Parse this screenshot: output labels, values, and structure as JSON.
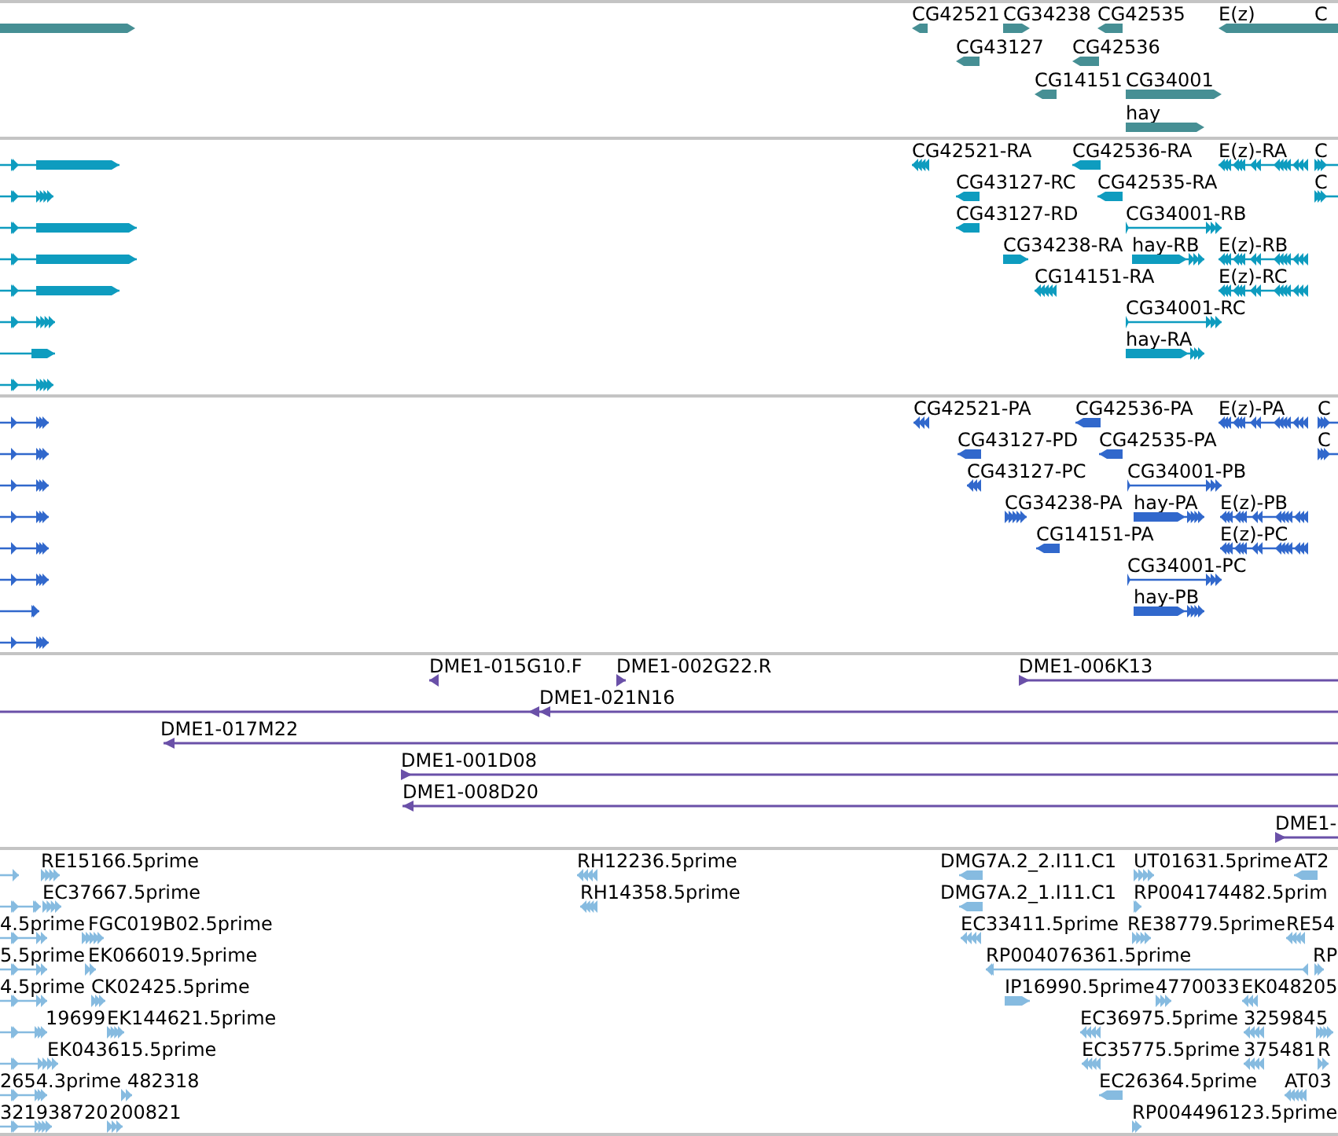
{
  "tracks": [
    {
      "kind": "gene",
      "color": "#468f94",
      "features": [
        {
          "reverse": false
        },
        {
          "label": "CG42521",
          "reverse": true
        },
        {
          "label": "CG34238",
          "reverse": false
        },
        {
          "label": "CG42535",
          "reverse": true
        },
        {
          "label": "E(z)",
          "reverse": true
        },
        {
          "label": "C",
          "reverse": false
        },
        {
          "label": "CG43127",
          "reverse": true
        },
        {
          "label": "CG42536",
          "reverse": true
        },
        {
          "label": "CG14151",
          "reverse": true
        },
        {
          "label": "CG34001",
          "reverse": false
        },
        {
          "label": "hay",
          "reverse": false
        }
      ]
    },
    {
      "kind": "transcript",
      "color": "#0e9cbf",
      "features": [
        {
          "reverse": false
        },
        {
          "label": "CG42521-RA",
          "reverse": true
        },
        {
          "label": "CG42536-RA",
          "reverse": true
        },
        {
          "label": "E(z)-RA",
          "reverse": true
        },
        {
          "label": "C",
          "reverse": false
        },
        {
          "reverse": false
        },
        {
          "label": "CG43127-RC",
          "reverse": true
        },
        {
          "label": "CG42535-RA",
          "reverse": true
        },
        {
          "label": "C",
          "reverse": false
        },
        {
          "reverse": false
        },
        {
          "label": "CG43127-RD",
          "reverse": true
        },
        {
          "label": "CG34001-RB",
          "reverse": false
        },
        {
          "reverse": false
        },
        {
          "label": "CG34238-RA",
          "reverse": false
        },
        {
          "label": "hay-RB",
          "reverse": false
        },
        {
          "label": "E(z)-RB",
          "reverse": true
        },
        {
          "reverse": false
        },
        {
          "label": "CG14151-RA",
          "reverse": true
        },
        {
          "label": "E(z)-RC",
          "reverse": true
        },
        {
          "reverse": false
        },
        {
          "label": "CG34001-RC",
          "reverse": false
        },
        {
          "reverse": false
        },
        {
          "label": "hay-RA",
          "reverse": false
        },
        {
          "reverse": false
        }
      ]
    },
    {
      "kind": "protein",
      "color": "#3168cc",
      "features": [
        {
          "reverse": false
        },
        {
          "label": "CG42521-PA",
          "reverse": true
        },
        {
          "label": "CG42536-PA",
          "reverse": true
        },
        {
          "label": "E(z)-PA",
          "reverse": true
        },
        {
          "label": "C",
          "reverse": false
        },
        {
          "reverse": false
        },
        {
          "label": "CG43127-PD",
          "reverse": true
        },
        {
          "label": "CG42535-PA",
          "reverse": true
        },
        {
          "label": "C",
          "reverse": false
        },
        {
          "reverse": false
        },
        {
          "label": "CG43127-PC",
          "reverse": true
        },
        {
          "label": "CG34001-PB",
          "reverse": false
        },
        {
          "reverse": false
        },
        {
          "label": "CG34238-PA",
          "reverse": false
        },
        {
          "label": "hay-PA",
          "reverse": false
        },
        {
          "label": "E(z)-PB",
          "reverse": true
        },
        {
          "reverse": false
        },
        {
          "label": "CG14151-PA",
          "reverse": true
        },
        {
          "label": "E(z)-PC",
          "reverse": true
        },
        {
          "reverse": false
        },
        {
          "label": "CG34001-PC",
          "reverse": false
        },
        {
          "reverse": false
        },
        {
          "label": "hay-PB",
          "reverse": false
        },
        {
          "reverse": false
        }
      ]
    },
    {
      "kind": "clone",
      "color": "#6a50a8",
      "features": [
        {
          "label": "DME1-015G10.F",
          "reverse": true
        },
        {
          "label": "DME1-002G22.R",
          "reverse": false
        },
        {
          "label": "DME1-006K13",
          "reverse": false
        },
        {
          "reverse": true
        },
        {
          "label": "DME1-021N16",
          "reverse": true
        },
        {
          "label": "DME1-017M22",
          "reverse": true
        },
        {
          "label": "DME1-001D08",
          "reverse": false
        },
        {
          "label": "DME1-008D20",
          "reverse": true
        },
        {
          "label": "DME1-",
          "reverse": false
        }
      ]
    },
    {
      "kind": "est",
      "color": "#86bbe0",
      "features": [
        {
          "reverse": false
        },
        {
          "label": "RE15166.5prime",
          "reverse": false
        },
        {
          "label": "RH12236.5prime",
          "reverse": true
        },
        {
          "label": "DMG7A.2_2.I11.C1",
          "reverse": true
        },
        {
          "label": "UT01631.5prime",
          "reverse": false
        },
        {
          "label": "AT2",
          "reverse": true
        },
        {
          "reverse": false
        },
        {
          "label": "EC37667.5prime",
          "reverse": false
        },
        {
          "label": "RH14358.5prime",
          "reverse": true
        },
        {
          "label": "DMG7A.2_1.I11.C1",
          "reverse": true
        },
        {
          "label": "RP004174482.5prim",
          "reverse": false
        },
        {
          "label": "4.5prime",
          "reverse": false
        },
        {
          "label": "FGC019B02.5prime",
          "reverse": false
        },
        {
          "label": "EC33411.5prime",
          "reverse": true
        },
        {
          "label": "RE38779.5prime",
          "reverse": false
        },
        {
          "label": "RE54",
          "reverse": true
        },
        {
          "label": "5.5prime",
          "reverse": false
        },
        {
          "label": "EK066019.5prime",
          "reverse": false
        },
        {
          "label": "RP004076361.5prime",
          "reverse": true
        },
        {
          "label": "RP",
          "reverse": false
        },
        {
          "label": "4.5prime",
          "reverse": false
        },
        {
          "label": "CK02425.5prime",
          "reverse": false
        },
        {
          "label": "IP16990.5prime",
          "reverse": false
        },
        {
          "label": "4770033",
          "reverse": false
        },
        {
          "label": "EK048205",
          "reverse": true
        },
        {
          "label": "19699",
          "reverse": false
        },
        {
          "label": "EK144621.5prime",
          "reverse": false
        },
        {
          "label": "EC36975.5prime",
          "reverse": true
        },
        {
          "label": "325984",
          "reverse": true
        },
        {
          "label": "5",
          "reverse": false
        },
        {
          "label": "EK043615.5prime",
          "reverse": false
        },
        {
          "label": "EC35775.5prime",
          "reverse": true
        },
        {
          "label": "375481",
          "reverse": true
        },
        {
          "label": "R",
          "reverse": false
        },
        {
          "label": "2654.3prime",
          "reverse": false
        },
        {
          "label": "482318",
          "reverse": false
        },
        {
          "label": "EC26364.5prime",
          "reverse": true
        },
        {
          "label": "AT03",
          "reverse": true
        },
        {
          "label": "321938720",
          "reverse": false
        },
        {
          "label": "200821",
          "reverse": false
        },
        {
          "label": "RP004496123.5prime",
          "reverse": false
        }
      ]
    }
  ]
}
